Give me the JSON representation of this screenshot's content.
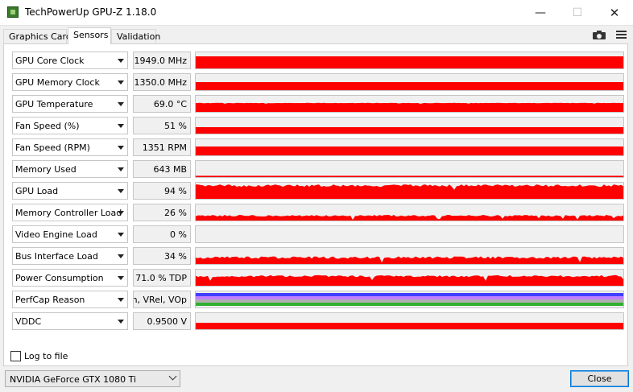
{
  "window": {
    "title": "TechPowerUp GPU-Z 1.18.0",
    "controls": {
      "minimize": "—",
      "maximize": "☐",
      "close": "✕"
    }
  },
  "tabs": [
    {
      "label": "Graphics Card",
      "active": false
    },
    {
      "label": "Sensors",
      "active": true
    },
    {
      "label": "Validation",
      "active": false
    }
  ],
  "toolbar": {
    "camera_icon": "camera-icon",
    "menu_icon": "hamburger-menu-icon"
  },
  "graph_color": "#ff0000",
  "sensors": [
    {
      "label": "GPU Core Clock",
      "value": "1949.0 MHz",
      "level": 0.75,
      "variability": 0
    },
    {
      "label": "GPU Memory Clock",
      "value": "1350.0 MHz",
      "level": 0.5,
      "variability": 0
    },
    {
      "label": "GPU Temperature",
      "value": "69.0 °C",
      "level": 0.55,
      "variability": 0.02
    },
    {
      "label": "Fan Speed (%)",
      "value": "51 %",
      "level": 0.4,
      "variability": 0
    },
    {
      "label": "Fan Speed (RPM)",
      "value": "1351 RPM",
      "level": 0.55,
      "variability": 0
    },
    {
      "label": "Memory Used",
      "value": "643 MB",
      "level": 0.08,
      "variability": 0
    },
    {
      "label": "GPU Load",
      "value": "94 %",
      "level": 0.82,
      "variability": 0.15
    },
    {
      "label": "Memory Controller Load",
      "value": "26 %",
      "level": 0.3,
      "variability": 0.1
    },
    {
      "label": "Video Engine Load",
      "value": "0 %",
      "level": 0,
      "variability": 0
    },
    {
      "label": "Bus Interface Load",
      "value": "34 %",
      "level": 0.4,
      "variability": 0.15
    },
    {
      "label": "Power Consumption",
      "value": "71.0 % TDP",
      "level": 0.6,
      "variability": 0.12
    },
    {
      "label": "PerfCap Reason",
      "value": "m, VRel, VOp",
      "level": 0,
      "variability": 0,
      "perfcap": true
    },
    {
      "label": "VDDC",
      "value": "0.9500 V",
      "level": 0.4,
      "variability": 0
    }
  ],
  "perfcap_colors": [
    "#4040ff",
    "#c080ff",
    "#b0b0b0",
    "#30b030"
  ],
  "log_to_file": {
    "label": "Log to file",
    "checked": false
  },
  "gpu_select": {
    "value": "NVIDIA GeForce GTX 1080 Ti"
  },
  "close_button": {
    "label": "Close"
  }
}
